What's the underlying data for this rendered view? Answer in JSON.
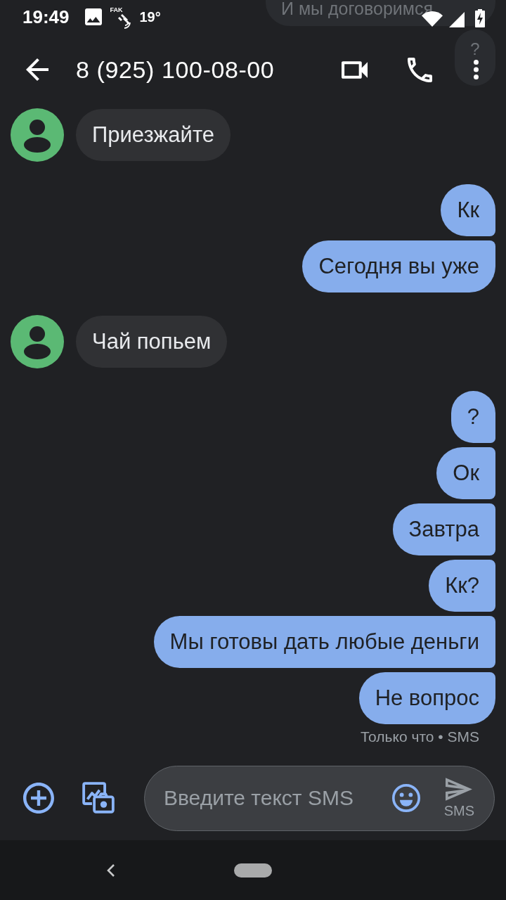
{
  "status_bar": {
    "time": "19:49",
    "gps_label": "FAK",
    "temperature": "19°"
  },
  "faded_bubbles": [
    {
      "text": "И мы договоримся"
    },
    {
      "text": "?"
    }
  ],
  "app_bar": {
    "title": "8 (925) 100-08-00"
  },
  "messages": [
    {
      "kind": "incoming",
      "text": "Приезжайте"
    },
    {
      "kind": "outgoing",
      "text": "Кк"
    },
    {
      "kind": "outgoing",
      "text": "Сегодня вы уже"
    },
    {
      "kind": "incoming",
      "text": "Чай попьем"
    },
    {
      "kind": "outgoing",
      "text": "?"
    },
    {
      "kind": "outgoing",
      "text": "Ок"
    },
    {
      "kind": "outgoing",
      "text": "Завтра"
    },
    {
      "kind": "outgoing",
      "text": "Кк?"
    },
    {
      "kind": "outgoing",
      "text": "Мы готовы дать любые деньги"
    },
    {
      "kind": "outgoing",
      "text": "Не вопрос"
    }
  ],
  "message_status": "Только что • SMS",
  "composer": {
    "placeholder": "Введите текст SMS",
    "send_label": "SMS"
  }
}
